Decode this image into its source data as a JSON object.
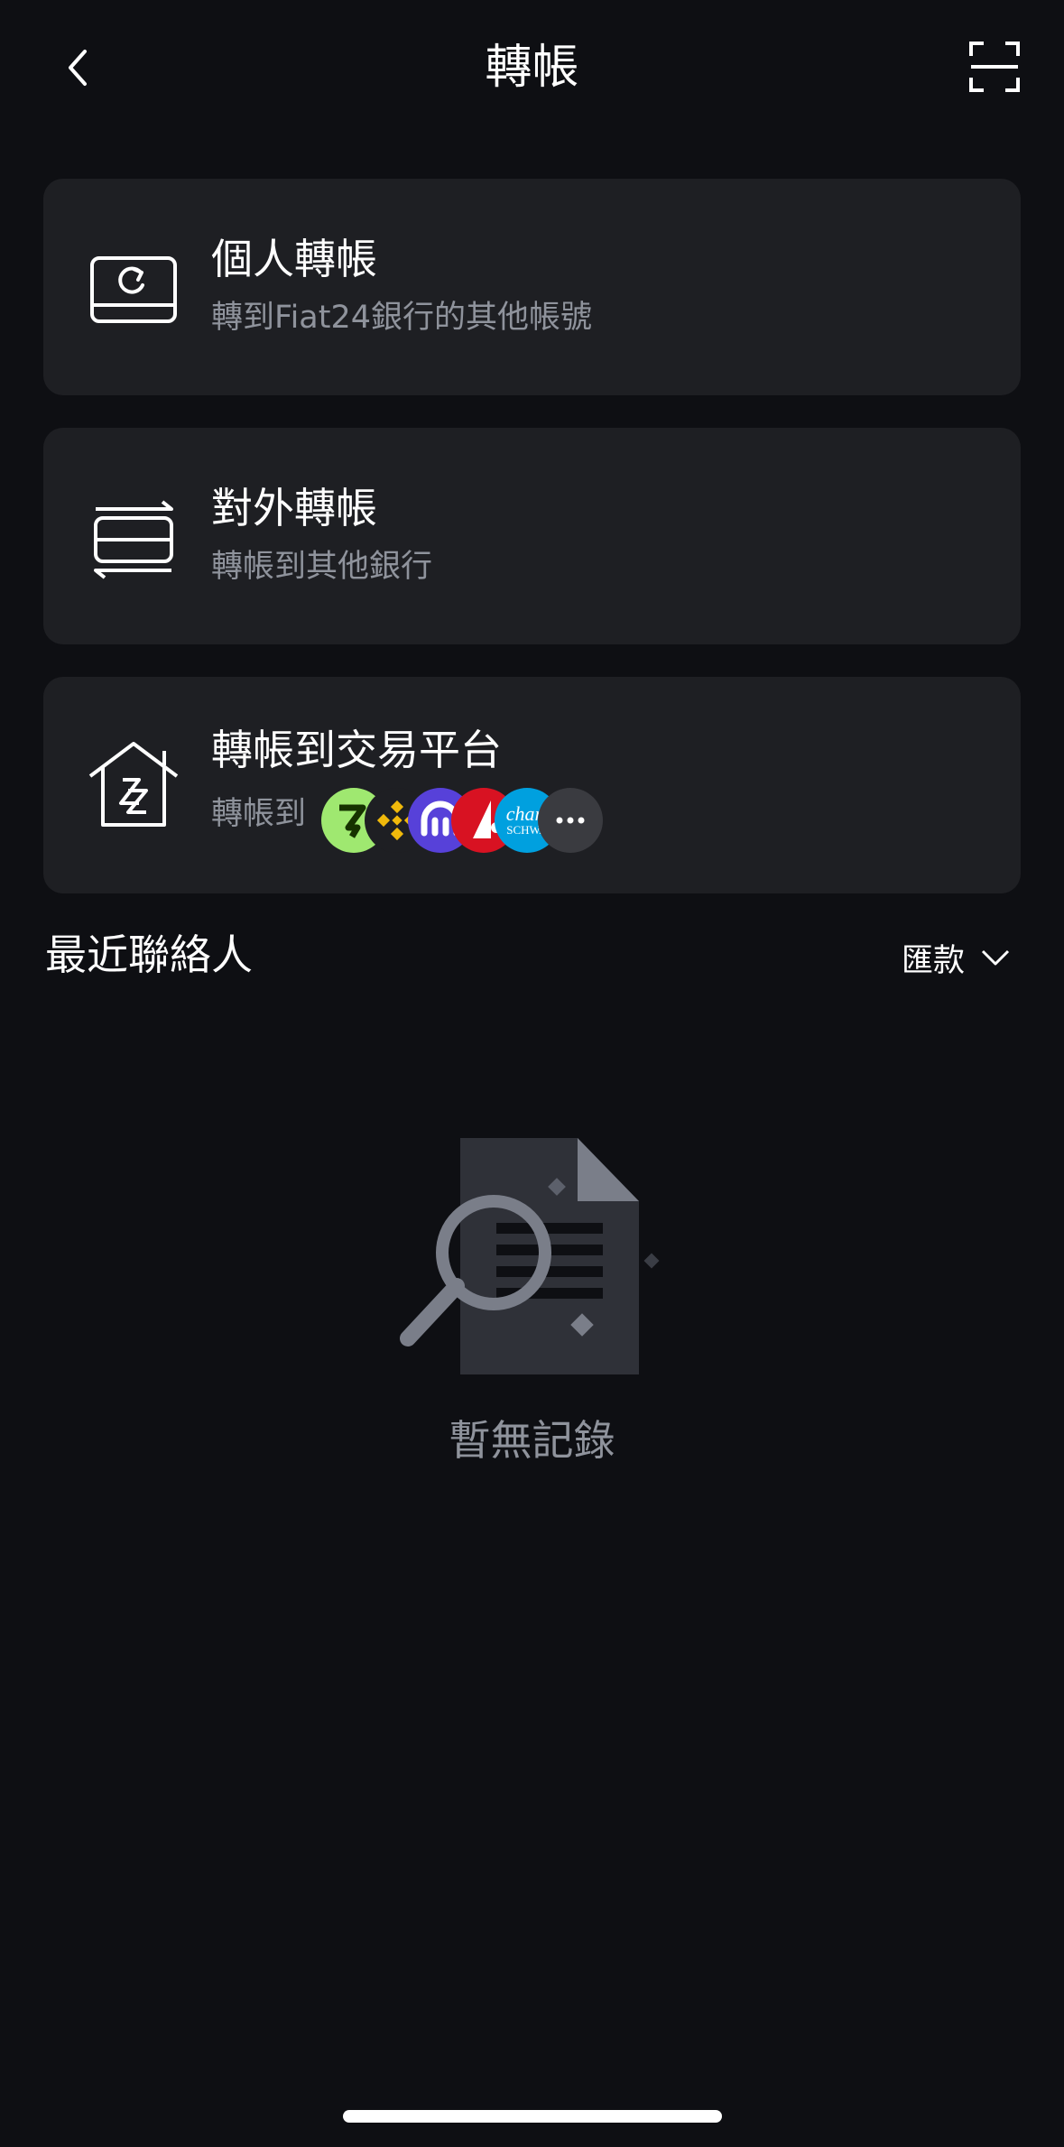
{
  "header": {
    "title": "轉帳"
  },
  "options": [
    {
      "title": "個人轉帳",
      "subtitle": "轉到Fiat24銀行的其他帳號"
    },
    {
      "title": "對外轉帳",
      "subtitle": "轉帳到其他銀行"
    },
    {
      "title": "轉帳到交易平台",
      "subtitle": "轉帳到"
    }
  ],
  "platform_logos": [
    "wise-logo",
    "binance-logo",
    "kraken-logo",
    "interactive-brokers-logo",
    "charles-schwab-logo",
    "more-icon"
  ],
  "platform_logo_texts": {
    "schwab_line1": "charl",
    "schwab_line2": "SCHWA"
  },
  "recent_contacts": {
    "title": "最近聯絡人",
    "filter_label": "匯款"
  },
  "empty_state": {
    "text": "暫無記錄"
  },
  "colors": {
    "background": "#0e0f13",
    "card": "#1e1f23",
    "secondary_text": "#8f939c"
  }
}
